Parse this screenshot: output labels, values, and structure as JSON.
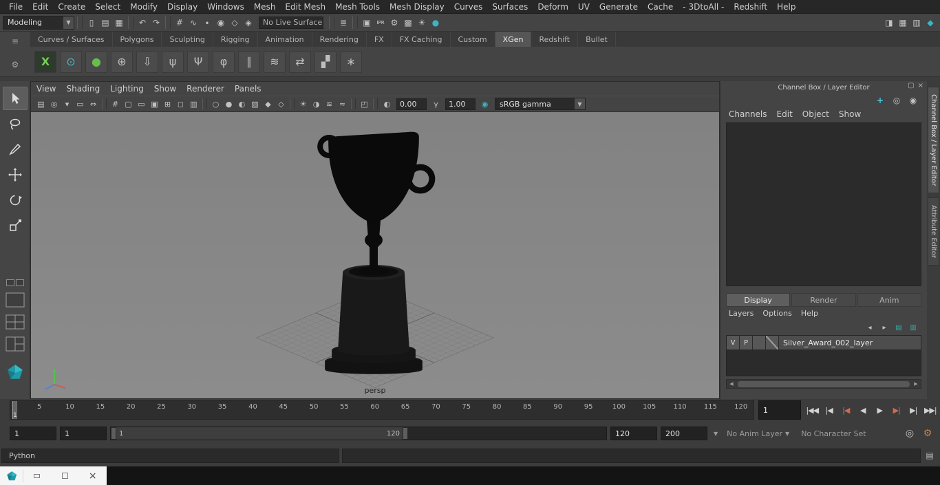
{
  "menubar": {
    "items": [
      "File",
      "Edit",
      "Create",
      "Select",
      "Modify",
      "Display",
      "Windows",
      "Mesh",
      "Edit Mesh",
      "Mesh Tools",
      "Mesh Display",
      "Curves",
      "Surfaces",
      "Deform",
      "UV",
      "Generate",
      "Cache",
      "- 3DtoAll -",
      "Redshift",
      "Help"
    ]
  },
  "statusline": {
    "mode_selector": "Modeling",
    "live_surface_field": "No Live Surface",
    "icons_a": [
      {
        "name": "section-divider",
        "glyph": "",
        "cls": "sep"
      },
      {
        "name": "new-scene-icon",
        "glyph": "▯"
      },
      {
        "name": "open-scene-icon",
        "glyph": "▤"
      },
      {
        "name": "save-scene-icon",
        "glyph": "▦"
      },
      {
        "name": "section-divider",
        "glyph": "",
        "cls": "sep"
      },
      {
        "name": "undo-icon",
        "glyph": "↶"
      },
      {
        "name": "redo-icon",
        "glyph": "↷"
      },
      {
        "name": "section-divider",
        "glyph": "",
        "cls": "sep"
      },
      {
        "name": "snap-to-grid-icon",
        "glyph": "#"
      },
      {
        "name": "snap-to-curve-icon",
        "glyph": "∿"
      },
      {
        "name": "snap-to-point-icon",
        "glyph": "∙"
      },
      {
        "name": "snap-to-projected-center-icon",
        "glyph": "◉"
      },
      {
        "name": "snap-to-view-plane-icon",
        "glyph": "◇"
      },
      {
        "name": "make-object-live-icon",
        "glyph": "◈"
      }
    ],
    "icons_b": [
      {
        "name": "section-divider",
        "glyph": "",
        "cls": "sep"
      },
      {
        "name": "construction-history-icon",
        "glyph": "≣"
      },
      {
        "name": "section-divider",
        "glyph": "",
        "cls": "sep"
      },
      {
        "name": "render-current-frame-icon",
        "glyph": "▣"
      },
      {
        "name": "ipr-render-icon",
        "glyph": "IPR",
        "cls": "tiny"
      },
      {
        "name": "render-settings-icon",
        "glyph": "⚙"
      },
      {
        "name": "render-setup-icon",
        "glyph": "▩"
      },
      {
        "name": "light-editor-icon",
        "glyph": "☀"
      },
      {
        "name": "render-view-icon",
        "glyph": "●",
        "cls": "teal"
      }
    ],
    "right_icons": [
      {
        "name": "sidebar-toggle-icon",
        "glyph": "◨"
      },
      {
        "name": "panel-layout-icon",
        "glyph": "▦"
      },
      {
        "name": "panel-layout-alt-icon",
        "glyph": "▥"
      },
      {
        "name": "modeling-toolkit-icon",
        "glyph": "◆",
        "cls": "teal"
      }
    ]
  },
  "shelf": {
    "left_icons": [
      {
        "name": "shelf-menu-icon",
        "glyph": "≡"
      },
      {
        "name": "shelf-gear-icon",
        "glyph": "⚙"
      }
    ],
    "tabs": [
      {
        "label": "Curves / Surfaces"
      },
      {
        "label": "Polygons"
      },
      {
        "label": "Sculpting"
      },
      {
        "label": "Rigging"
      },
      {
        "label": "Animation"
      },
      {
        "label": "Rendering"
      },
      {
        "label": "FX"
      },
      {
        "label": "FX Caching"
      },
      {
        "label": "Custom"
      },
      {
        "label": "XGen",
        "state": "active"
      },
      {
        "label": "Redshift"
      },
      {
        "label": "Bullet"
      }
    ],
    "icons": [
      {
        "name": "xgen-create-description-icon",
        "glyph": "X",
        "cls": "xgreen"
      },
      {
        "name": "xgen-description-editor-icon",
        "glyph": "⊙",
        "cls": "teal"
      },
      {
        "name": "xgen-create-interactive-groom-icon",
        "glyph": "●",
        "cls": "green"
      },
      {
        "name": "xgen-add-guides-icon",
        "glyph": "⊕"
      },
      {
        "name": "xgen-export-selection-icon",
        "glyph": "⇩"
      },
      {
        "name": "xgen-comb-guides-icon",
        "glyph": "ψ"
      },
      {
        "name": "xgen-sculpt-guides-icon",
        "glyph": "Ψ"
      },
      {
        "name": "xgen-guide-utilities-icon",
        "glyph": "φ"
      },
      {
        "name": "xgen-curves-icon",
        "glyph": "∥"
      },
      {
        "name": "xgen-modifier-stack-icon",
        "glyph": "≋"
      },
      {
        "name": "xgen-convert-icon",
        "glyph": "⇄"
      },
      {
        "name": "xgen-grass-preset-icon",
        "glyph": "▞"
      },
      {
        "name": "xgen-groomable-preset-icon",
        "glyph": "∗"
      }
    ]
  },
  "panel": {
    "menus": [
      "View",
      "Shading",
      "Lighting",
      "Show",
      "Renderer",
      "Panels"
    ],
    "toolbar": {
      "icons": [
        {
          "name": "scene-camera-icon",
          "glyph": "▤"
        },
        {
          "name": "camera-attributes-icon",
          "glyph": "◎"
        },
        {
          "name": "bookmarks-icon",
          "glyph": "▾"
        },
        {
          "name": "image-plane-icon",
          "glyph": "▭"
        },
        {
          "name": "2d-pan-zoom-icon",
          "glyph": "⇔"
        },
        {
          "name": "divider",
          "glyph": "",
          "cls": "sep"
        },
        {
          "name": "grid-toggle-icon",
          "glyph": "#"
        },
        {
          "name": "film-gate-icon",
          "glyph": "▢"
        },
        {
          "name": "resolution-gate-icon",
          "glyph": "▭"
        },
        {
          "name": "gate-mask-icon",
          "glyph": "▣"
        },
        {
          "name": "field-chart-icon",
          "glyph": "⊞"
        },
        {
          "name": "safe-action-icon",
          "glyph": "◻"
        },
        {
          "name": "safe-title-icon",
          "glyph": "▥"
        },
        {
          "name": "divider",
          "glyph": "",
          "cls": "sep"
        },
        {
          "name": "wireframe-icon",
          "glyph": "○"
        },
        {
          "name": "smooth-shade-icon",
          "glyph": "●"
        },
        {
          "name": "wireframe-on-shaded-icon",
          "glyph": "◐"
        },
        {
          "name": "textured-icon",
          "glyph": "▧"
        },
        {
          "name": "use-default-material-icon",
          "glyph": "◆"
        },
        {
          "name": "xray-icon",
          "glyph": "◇"
        },
        {
          "name": "divider",
          "glyph": "",
          "cls": "sep"
        },
        {
          "name": "use-all-lights-icon",
          "glyph": "☀"
        },
        {
          "name": "shadows-icon",
          "glyph": "◑"
        },
        {
          "name": "screen-space-ao-icon",
          "glyph": "≋"
        },
        {
          "name": "motion-blur-icon",
          "glyph": "≈"
        },
        {
          "name": "divider",
          "glyph": "",
          "cls": "sep"
        },
        {
          "name": "isolate-select-icon",
          "glyph": "◰"
        },
        {
          "name": "divider",
          "glyph": "",
          "cls": "sep"
        }
      ],
      "exposure_icon": "◐",
      "exposure_value": "0.00",
      "gamma_icon": "γ",
      "gamma_value": "1.00",
      "color_managed_icon": "◉",
      "view_transform": "sRGB gamma"
    },
    "camera_label": "persp"
  },
  "channel_box": {
    "title": "Channel Box / Layer Editor",
    "window_icons": [
      {
        "name": "dock-panel-icon",
        "glyph": "▢"
      },
      {
        "name": "close-panel-icon",
        "glyph": "×"
      }
    ],
    "display_icons": [
      {
        "name": "show-manipulators-icon",
        "glyph": "+",
        "cls": "cyan"
      },
      {
        "name": "speed-slow-icon",
        "glyph": "◎"
      },
      {
        "name": "speed-fast-icon",
        "glyph": "◉"
      }
    ],
    "menus": [
      "Channels",
      "Edit",
      "Object",
      "Show"
    ],
    "tabs": [
      {
        "label": "Display",
        "state": "active"
      },
      {
        "label": "Render"
      },
      {
        "label": "Anim"
      }
    ],
    "layer_menus": [
      "Layers",
      "Options",
      "Help"
    ],
    "layer_buttons": [
      {
        "name": "move-layer-up-icon",
        "glyph": "◂"
      },
      {
        "name": "move-layer-down-icon",
        "glyph": "▸"
      },
      {
        "name": "create-empty-layer-icon",
        "glyph": "▤",
        "cls": "teal"
      },
      {
        "name": "create-layer-from-selected-icon",
        "glyph": "▥",
        "cls": "teal"
      }
    ],
    "layer_row": {
      "visibility": "V",
      "playback": "P",
      "name": "Silver_Award_002_layer"
    }
  },
  "side_tabs": [
    {
      "label": "Channel Box / Layer Editor",
      "state": "active"
    },
    {
      "label": "Attribute Editor"
    }
  ],
  "timeline": {
    "start_label": "1",
    "current_frame": "1",
    "ticks": [
      "5",
      "10",
      "15",
      "20",
      "25",
      "30",
      "35",
      "40",
      "45",
      "50",
      "55",
      "60",
      "65",
      "70",
      "75",
      "80",
      "85",
      "90",
      "95",
      "100",
      "105",
      "110",
      "115",
      "120"
    ],
    "playback": [
      {
        "name": "go-to-start-button",
        "glyph": "|◀◀"
      },
      {
        "name": "step-back-frame-button",
        "glyph": "|◀"
      },
      {
        "name": "step-back-key-button",
        "glyph": "|◀",
        "cls": "red"
      },
      {
        "name": "play-backwards-button",
        "glyph": "◀"
      },
      {
        "name": "play-forwards-button",
        "glyph": "▶"
      },
      {
        "name": "step-forward-key-button",
        "glyph": "▶|",
        "cls": "red"
      },
      {
        "name": "step-forward-frame-button",
        "glyph": "▶|"
      },
      {
        "name": "go-to-end-button",
        "glyph": "▶▶|"
      }
    ]
  },
  "range_slider": {
    "anim_start": "1",
    "playback_start": "1",
    "bar_start_label": "1",
    "bar_end_label": "120",
    "playback_end": "120",
    "anim_end": "200",
    "anim_layer_label": "No Anim Layer",
    "character_set_label": "No Character Set",
    "icons": [
      {
        "name": "auto-keyframe-toggle-icon",
        "glyph": "◎"
      },
      {
        "name": "animation-preferences-icon",
        "glyph": "⚙",
        "cls": "orange"
      }
    ]
  },
  "command_line": {
    "language_label": "Python",
    "script_editor_icon": "▤"
  },
  "window_fragment": {
    "close_glyph": "×"
  }
}
